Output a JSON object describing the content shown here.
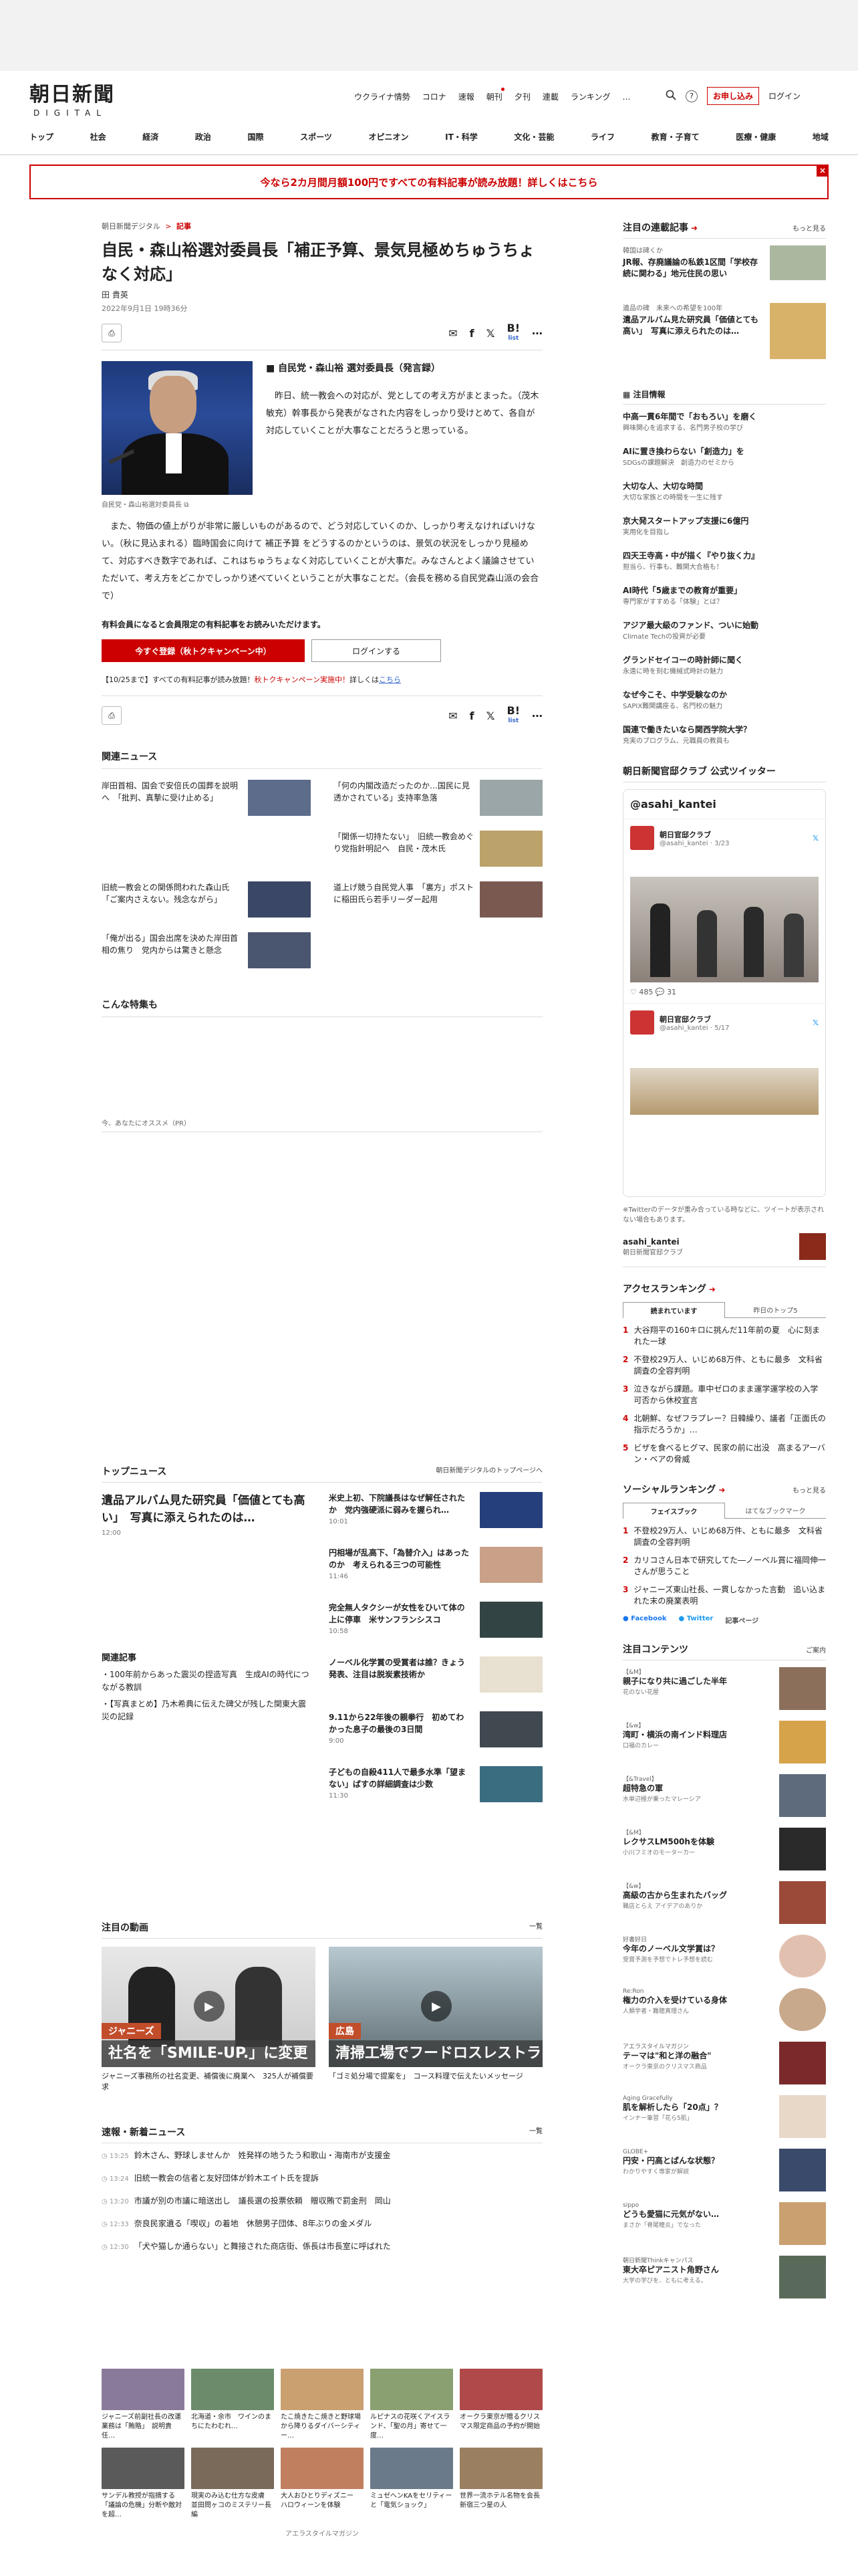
{
  "brand": {
    "logo_main": "朝日新聞",
    "logo_sub": "DIGITAL"
  },
  "header": {
    "util_links": [
      "ウクライナ情勢",
      "コロナ",
      "速報",
      "朝刊",
      "夕刊",
      "連載",
      "ランキング",
      "…"
    ],
    "apply_label": "お申し込み",
    "login_label": "ログイン",
    "help": "?"
  },
  "gnav": [
    "トップ",
    "社会",
    "経済",
    "政治",
    "国際",
    "スポーツ",
    "オピニオン",
    "IT・科学",
    "文化・芸能",
    "ライフ",
    "教育・子育て",
    "医療・健康",
    "地域"
  ],
  "banner": {
    "text": "今なら2カ月間月額100円ですべての有料記事が読み放題！詳しくはこちら",
    "close": "×"
  },
  "article": {
    "breadcrumb_site": "朝日新聞デジタル",
    "breadcrumb_sep": ">",
    "breadcrumb_cat": "記事",
    "title": "自民・森山裕選対委員長「補正予算、景気見極めちゅうちょなく対応」",
    "author": "田 貴英",
    "date": "2022年9月1日 19時36分",
    "list_label": "list",
    "image_caption": "自民党・森山裕選対委員長",
    "subhead": "■ 自民党・森山裕 選対委員長（発言録）",
    "para1": "昨日、統一教会への対応が、党としての考え方がまとまった。（茂木敏充）幹事長から発表がなされた内容をしっかり受けとめて、各自が対応していくことが大事なことだろうと思っている。",
    "para2": "また、物価の値上がりが非常に厳しいものがあるので、どう対応していくのか、しっかり考えなければいけない。（秋に見込まれる）臨時国会に向けて 補正予算 をどうするのかというのは、景気の状況をしっかり見極めて、対応すべき数字であれば、これはちゅうちょなく対応していくことが大事だ。みなさんとよく議論させていただいて、考え方をどこかでしっかり述べていくということが大事なことだ。（会長を務める自民党森山派の会合で）",
    "paywall_note": "有料会員になると会員限定の有料記事をお読みいただけます。",
    "register_label": "今すぐ登録（秋トクキャンペーン中）",
    "login_label": "ログインする",
    "campaign_prefix": "【10/25まで】すべての有料記事が読み放題！",
    "campaign_mid": "秋トクキャンペーン実施中！",
    "campaign_link_pre": "詳しくは",
    "campaign_link": "こちら"
  },
  "related": {
    "title": "関連ニュース",
    "items": [
      "岸田首相、国会で安倍氏の国葬を説明へ　「批判、真摯に受け止める」",
      "「何の内閣改造だったのか…国民に見透かされている」支持率急落",
      "「関係一切持たない」　旧統一教会めぐり党指針明記へ　自民・茂木氏",
      "旧統一教会との関係問われた森山氏　「ご案内さえない。残念ながら」",
      "道上げ競う自民党人事　「裏方」ポストに稲田氏ら若手リーダー起用",
      "「俺が出る」国会出席を決めた岸田首相の焦り　党内からは驚きと懸念"
    ]
  },
  "special": {
    "title": "こんな特集も",
    "recommend": "今、あなたにオススメ（PR）"
  },
  "topnews": {
    "title": "トップニュース",
    "link": "朝日新聞デジタルのトップページへ",
    "lead_title": "遺品アルバム見た研究員「価値とても高い」　写真に添えられたのは…",
    "lead_time": "12:00",
    "items": [
      {
        "t": "米史上初、下院議長はなぜ解任されたか　党内強硬派に弱みを握られ…",
        "time": "10:01"
      },
      {
        "t": "円相場が乱高下、「為替介入」はあったのか　考えられる三つの可能性",
        "time": "11:46"
      },
      {
        "t": "完全無人タクシーが女性をひいて体の上に停車　米サンフランシスコ",
        "time": "10:58"
      },
      {
        "t": "ノーベル化学賞の受賞者は誰？きょう発表、注目は脱炭素技術か",
        "time": ""
      },
      {
        "t": "9.11から22年後の親拳行　初めてわかった息子の最後の3日間",
        "time": "9:00"
      },
      {
        "t": "子どもの自殺411人で最多水準「望まない」ばすの詳細調査は少数",
        "time": "11:30"
      }
    ],
    "related_title": "関連記事",
    "related_items": [
      "100年前からあった震災の捏造写真　生成AIの時代につながる教訓",
      "【写真まとめ】乃木希典に伝えた碑父が残した関東大震災の記録"
    ]
  },
  "videos": {
    "title": "注目の動画",
    "more": "一覧",
    "items": [
      {
        "caption": "ジャニーズ事務所の社名変更、補償後に廃業へ　325人が補償要求",
        "label": "社名を「SMILE-UP.」に変更",
        "tag": "ジャニーズ"
      },
      {
        "caption": "「ゴミ処分場で提案を」　コース料理で伝えたいメッセージ",
        "label": "清掃工場でフードロスレストラン",
        "tag": "広島"
      }
    ]
  },
  "flash": {
    "title": "速報・新着ニュース",
    "more": "一覧",
    "items": [
      {
        "time": "13:25",
        "t": "鈴木さん、野球しませんか　姓発祥の地うたう和歌山・海南市が支援金"
      },
      {
        "time": "13:24",
        "t": "旧統一教会の信者と友好団体が鈴木エイト氏を提訴"
      },
      {
        "time": "13:20",
        "t": "市議が別の市議に暗送出し　議長選の投票依頼　贈収賄で罰金刑　岡山"
      },
      {
        "time": "12:33",
        "t": "奈良民家遺る「喫収」の着地　休憩男子団体、8年ぶりの金メダル"
      },
      {
        "time": "12:30",
        "t": "「犬や猫しか通らない」と舞接された商店街、係長は市長室に呼ばれた"
      }
    ]
  },
  "bottomgrid": [
    "ジャニーズ前副社長の改運業務は「賄賂」　説明責任…",
    "北海道・余市　ワインのまちにたわむれ…",
    "たこ焼きたこ焼きと野球場から降りるダイバーシティー…",
    "ルピナスの花咲くアイスランド、「聖の月」寄せて一度…",
    "オークラ東京が贈るクリスマス限定商品の予約が開始",
    "サンデル教授が指摘する「議論の危機」分断や敵対を超…",
    "現実のみ込む仕方な皮膚　並田問ヶコのミステリー長編",
    "大人おひとりディズニー　ハロウィーンを体験",
    "ミュゼヘンKAをセリティーと「電気ショック」",
    "世界一流ホテル名物を会長　新宿三つ星の人"
  ],
  "footer_pr": "アエラスタイルマガジン",
  "right": {
    "serial": {
      "title": "注目の連載記事",
      "more": "もっと見る",
      "items": [
        {
          "s": "韓国は碑くか",
          "t": "JR報、存廃議論の私鉄1区間「学校存続に関わる」地元住民の思い"
        },
        {
          "s": "遺品の碑　未来への希望を100年",
          "t": "遺品アルバム見た研究員「価値とても高い」　写真に添えられたのは…"
        }
      ]
    },
    "attention_label": "注目情報",
    "attention": [
      {
        "t": "中高一貫6年間で「おもろい」を磨く",
        "s": "興味関心を追求する、名門男子校の学び"
      },
      {
        "t": "AIに置き換わらない「創造力」を",
        "s": "SDGsの課題解決　創造力のゼミから"
      },
      {
        "t": "大切な人、大切な時間",
        "s": "大切な家族との時間を一生に残す"
      },
      {
        "t": "京大発スタートアップ支援に6億円",
        "s": "実用化を目指し"
      },
      {
        "t": "四天王寺高・中が描く『やり抜く力』",
        "s": "担当ら、行事も、難関大合格も！"
      },
      {
        "t": "AI時代「5歳までの教育が重要」",
        "s": "専門家がすすめる「体験」とは？"
      },
      {
        "t": "アジア最大級のファンド、ついに始動",
        "s": "Climate Techの投資が必要"
      },
      {
        "t": "グランドセイコーの時計師に聞く",
        "s": "永遠に時を刻む機械式時計の魅力"
      },
      {
        "t": "なぜ今こそ、中学受験なのか",
        "s": "SAPIX難関講座る、名門校の魅力"
      },
      {
        "t": "国連で働きたいなら関西学院大学？",
        "s": "充実のプログラム、元職員の教員も"
      }
    ],
    "twitter_title": "朝日新聞官邸クラブ 公式ツイッター",
    "twitter_handle": "@asahi_kantei",
    "tweet_name": "朝日官邸クラブ",
    "tweet_date1": "3/23",
    "tweet_date2": "5/17",
    "tweet_stats": "485",
    "tweet_stats2": "31",
    "tweet_notice": "※Twitterのデータが重み合っている時などに、ツイートが表示されない場合もあります。",
    "tweet_account": "asahi_kantei",
    "tweet_account_sub": "朝日新聞官邸クラブ",
    "ranking_title": "アクセスランキング",
    "ranking_tabs": [
      "読まれています",
      "昨日のトップ5"
    ],
    "ranking": [
      "大谷翔平の160キロに挑んだ11年前の夏　心に刻まれた一球",
      "不登校29万人、いじめ68万件、ともに最多　文科省調査の全容判明",
      "泣きながら課題。車中ゼロのまま運学運学校の入学可否から休校宣言",
      "北朝鮮、なぜフラプレー？日韓繰り、議者「正面氏の指示だろうか」…",
      "ビザを食べるヒグマ、民家の前に出没　高まるアーバン・ベアの脅威"
    ],
    "social_title": "ソーシャルランキング",
    "social_more": "もっと見る",
    "social_tabs": [
      "フェイスブック",
      "はてなブックマーク"
    ],
    "social": [
      "不登校29万人、いじめ68万件、ともに最多　文科省調査の全容判明",
      "カリコさん日本で研究してた―ノーベル賞に福岡伸一さんが思うこと",
      "ジャニーズ東山社長、一貫しなかった言動　追い込まれた末の廃業表明"
    ],
    "social_follow": [
      "Facebook",
      "Twitter",
      "記事ページ"
    ],
    "contents_title": "注目コンテンツ",
    "contents_more": "ご案内",
    "contents": [
      {
        "tag": "【&M】",
        "t": "親子になり共に過ごした半年",
        "s": "花のない花屋"
      },
      {
        "tag": "【&w】",
        "t": "湾町・横浜の南インド料理店",
        "s": "口福のカレー"
      },
      {
        "tag": "【&Travel】",
        "t": "超特急の軍　",
        "s": "水単辺極が乗ったマレーシア"
      },
      {
        "tag": "【&M】",
        "t": "レクサスLM500hを体験",
        "s": "小川フミオのモーターカー"
      },
      {
        "tag": "【&w】",
        "t": "高級の古から生まれたバッグ",
        "s": "職店とらえ アイデアのありか"
      },
      {
        "tag": "好書好日",
        "t": "今年のノーベル文学賞は？",
        "s": "受賞予測を予想でトレ予想を読む"
      },
      {
        "tag": "Re:Ron",
        "t": "権力の介入を受けている身体",
        "s": "人類学者・難聴真理さん"
      },
      {
        "tag": "アエラスタイルマガジン",
        "t": "テーマは\"和と洋の融合\"",
        "s": "オークラ東京のクリスマス商品"
      },
      {
        "tag": "Aging Gracefully",
        "t": "肌を解析したら「20点」？",
        "s": "インナー筆習「花ら5肌」"
      },
      {
        "tag": "GLOBE+",
        "t": "円安・円高とばんな状態？",
        "s": "わかりやすく専家が解説"
      },
      {
        "tag": "sippo",
        "t": "どうも愛猫に元気がない…",
        "s": "まさか「脊尾瞳炎」でなった"
      },
      {
        "tag": "朝日新聞Thinkキャンパス",
        "t": "東大卒ピアニスト角野さん",
        "s": "大学の学びを、ともに考える。"
      }
    ]
  }
}
